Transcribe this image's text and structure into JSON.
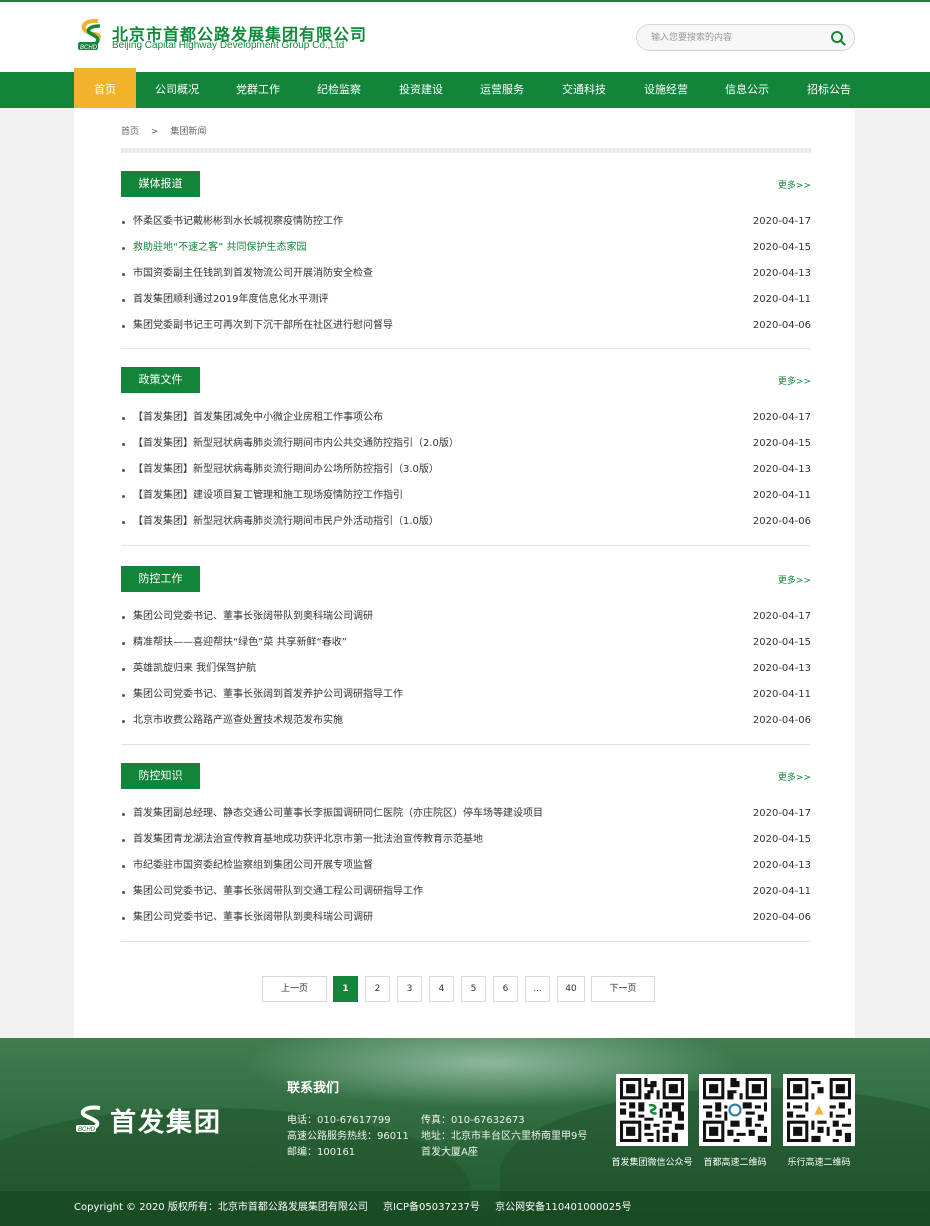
{
  "header": {
    "logo_cn": "北京市首都公路发展集团有限公司",
    "logo_en": "Beijing Capital Highway Development Group Co.,Ltd",
    "search_placeholder": "输入您要搜索的内容"
  },
  "nav": {
    "items": [
      "首页",
      "公司概况",
      "党群工作",
      "纪检监察",
      "投资建设",
      "运营服务",
      "交通科技",
      "设施经营",
      "信息公示",
      "招标公告"
    ],
    "active": "首页"
  },
  "breadcrumb": {
    "home": "首页",
    "sep": ">",
    "current": "集团新闻"
  },
  "sections": [
    {
      "title": "媒体报道",
      "more": "更多>>",
      "items": [
        {
          "title": "怀柔区委书记戴彬彬到水长城视察疫情防控工作",
          "date": "2020-04-17"
        },
        {
          "title": "救助驻地“不速之客” 共同保护生态家园",
          "date": "2020-04-15"
        },
        {
          "title": "市国资委副主任钱凯到首发物流公司开展消防安全检查",
          "date": "2020-04-13"
        },
        {
          "title": "首发集团顺利通过2019年度信息化水平测评",
          "date": "2020-04-11"
        },
        {
          "title": "集团党委副书记王可再次到下沉干部所在社区进行慰问督导",
          "date": "2020-04-06"
        }
      ]
    },
    {
      "title": "政策文件",
      "more": "更多>>",
      "items": [
        {
          "title": "【首发集团】首发集团减免中小微企业房租工作事项公布",
          "date": "2020-04-17"
        },
        {
          "title": "【首发集团】新型冠状病毒肺炎流行期间市内公共交通防控指引（2.0版）",
          "date": "2020-04-15"
        },
        {
          "title": "【首发集团】新型冠状病毒肺炎流行期间办公场所防控指引（3.0版）",
          "date": "2020-04-13"
        },
        {
          "title": "【首发集团】建设项目复工管理和施工现场疫情防控工作指引",
          "date": "2020-04-11"
        },
        {
          "title": "【首发集团】新型冠状病毒肺炎流行期间市民户外活动指引（1.0版）",
          "date": "2020-04-06"
        }
      ]
    },
    {
      "title": "防控工作",
      "more": "更多>>",
      "items": [
        {
          "title": "集团公司党委书记、董事长张阔带队到奥科瑞公司调研",
          "date": "2020-04-17"
        },
        {
          "title": "精准帮扶——喜迎帮扶“绿色”菜 共享新鲜“春收”",
          "date": "2020-04-15"
        },
        {
          "title": "英雄凯旋归来 我们保驾护航",
          "date": "2020-04-13"
        },
        {
          "title": "集团公司党委书记、董事长张阔到首发养护公司调研指导工作",
          "date": "2020-04-11"
        },
        {
          "title": "北京市收费公路路产巡查处置技术规范发布实施",
          "date": "2020-04-06"
        }
      ]
    },
    {
      "title": "防控知识",
      "more": "更多>>",
      "items": [
        {
          "title": "首发集团副总经理、静态交通公司董事长李振国调研同仁医院（亦庄院区）停车场等建设项目",
          "date": "2020-04-17"
        },
        {
          "title": "首发集团青龙湖法治宣传教育基地成功获评北京市第一批法治宣传教育示范基地",
          "date": "2020-04-15"
        },
        {
          "title": "市纪委驻市国资委纪检监察组到集团公司开展专项监督",
          "date": "2020-04-13"
        },
        {
          "title": "集团公司党委书记、董事长张阔带队到交通工程公司调研指导工作",
          "date": "2020-04-11"
        },
        {
          "title": "集团公司党委书记、董事长张阔带队到奥科瑞公司调研",
          "date": "2020-04-06"
        }
      ]
    }
  ],
  "pager": {
    "prev": "上一页",
    "pages": [
      "1",
      "2",
      "3",
      "4",
      "5",
      "6",
      "...",
      "40"
    ],
    "current": "1",
    "next": "下一页"
  },
  "footer": {
    "brand": "首发集团",
    "contact_title": "联系我们",
    "phone": "电话：010-67617799",
    "fax": "传真：010-67632673",
    "hotline": "高速公路服务热线：96011",
    "address1": "地址：北京市丰台区六里桥南里甲9号",
    "zip": "邮编：100161",
    "address2": "首发大厦A座",
    "qr": [
      {
        "caption": "首发集团微信公众号"
      },
      {
        "caption": "首都高速二维码"
      },
      {
        "caption": "乐行高速二维码"
      }
    ],
    "copyright": "Copyright © 2020 版权所有：北京市首都公路发展集团有限公司",
    "icp": "京ICP备05037237号",
    "police": "京公网安备110401000025号"
  },
  "colors": {
    "brand_green": "#13853b",
    "nav_active": "#f1b32b"
  },
  "icons": {
    "search": "search-icon",
    "logo": "bchd-logo-icon"
  }
}
